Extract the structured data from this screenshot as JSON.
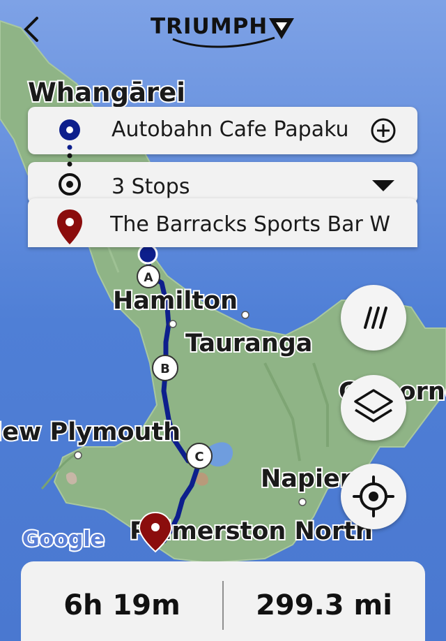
{
  "header": {
    "brand": "TRIUMPH",
    "back_icon": "chevron-left-icon"
  },
  "route": {
    "start": {
      "label": "Autobahn Cafe Papaku",
      "icon": "origin-dot-icon",
      "action_icon": "add-circle-icon"
    },
    "stops": {
      "label": "3 Stops",
      "icon": "waypoint-ring-icon",
      "expand_icon": "caret-down-icon"
    },
    "destination": {
      "label": "The Barracks Sports Bar W",
      "icon": "destination-pin-icon"
    }
  },
  "map": {
    "cities": [
      "Whangārei",
      "Hamilton",
      "Tauranga",
      "Gisborne",
      "New Plymouth",
      "Napier",
      "Palmerston North"
    ],
    "waypoints": [
      "A",
      "B",
      "C"
    ],
    "attribution": "Google",
    "colors": {
      "sea": "#5b86d9",
      "land": "#8fb486",
      "route": "#0d1f8c",
      "destination": "#8b0d0d"
    }
  },
  "controls": {
    "route_style_icon": "triple-slash-icon",
    "layers_icon": "layers-icon",
    "locate_icon": "crosshair-icon"
  },
  "summary": {
    "duration": "6h 19m",
    "distance": "299.3 mi"
  }
}
